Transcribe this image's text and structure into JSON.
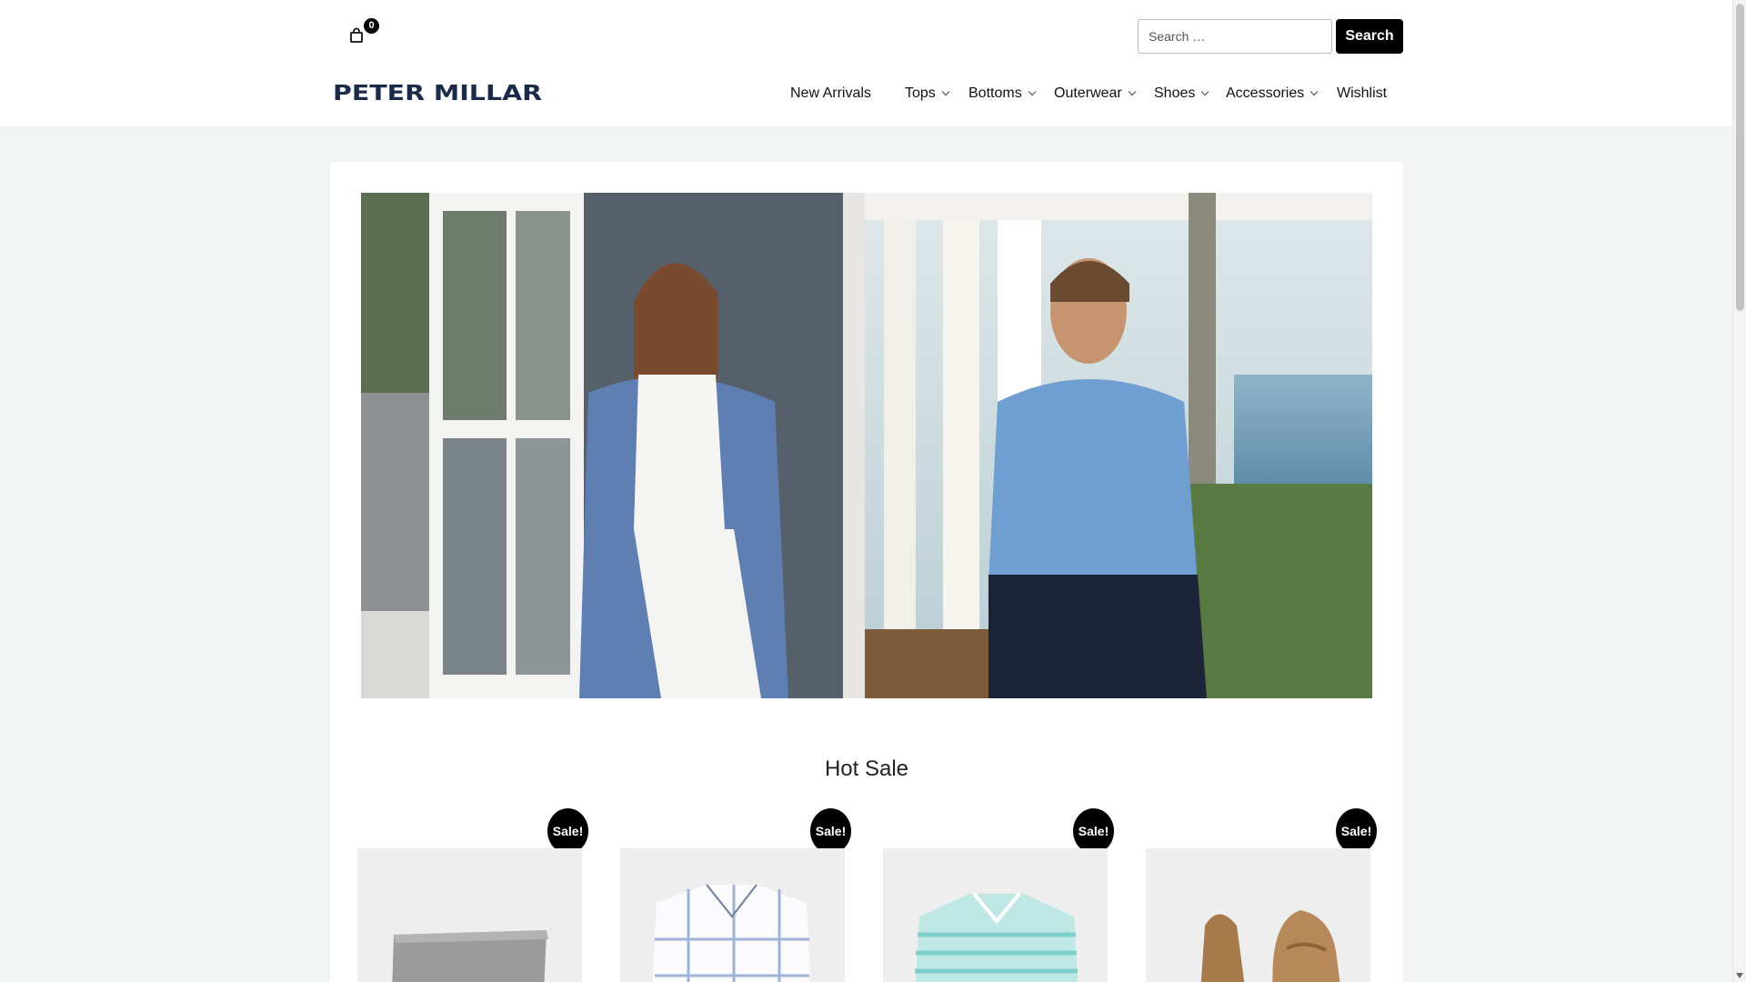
{
  "header": {
    "cart": {
      "icon": "shopping-bag-icon",
      "count": "0"
    },
    "search": {
      "placeholder": "Search …",
      "button_label": "Search"
    },
    "logo_text": "PETER MILLAR",
    "nav": [
      {
        "label": "New Arrivals",
        "has_dropdown": false
      },
      {
        "label": "Tops",
        "has_dropdown": true
      },
      {
        "label": "Bottoms",
        "has_dropdown": true
      },
      {
        "label": "Outerwear",
        "has_dropdown": true
      },
      {
        "label": "Shoes",
        "has_dropdown": true
      },
      {
        "label": "Accessories",
        "has_dropdown": true
      },
      {
        "label": "Wishlist",
        "has_dropdown": false
      }
    ]
  },
  "main": {
    "hero_alt": "woman in blue wrap and man in blue quarter-zip on a porch",
    "section_title": "Hot Sale",
    "products": [
      {
        "badge": "Sale!",
        "image": "grey-knit-scarf"
      },
      {
        "badge": "Sale!",
        "image": "white-blue-check-shirt"
      },
      {
        "badge": "Sale!",
        "image": "teal-striped-polo"
      },
      {
        "badge": "Sale!",
        "image": "tan-knit-loafers"
      }
    ]
  },
  "colors": {
    "page_background": "#f1f4f2",
    "header_background": "#ffffff",
    "button_background": "#000000",
    "logo_color": "#1c2a4a"
  }
}
